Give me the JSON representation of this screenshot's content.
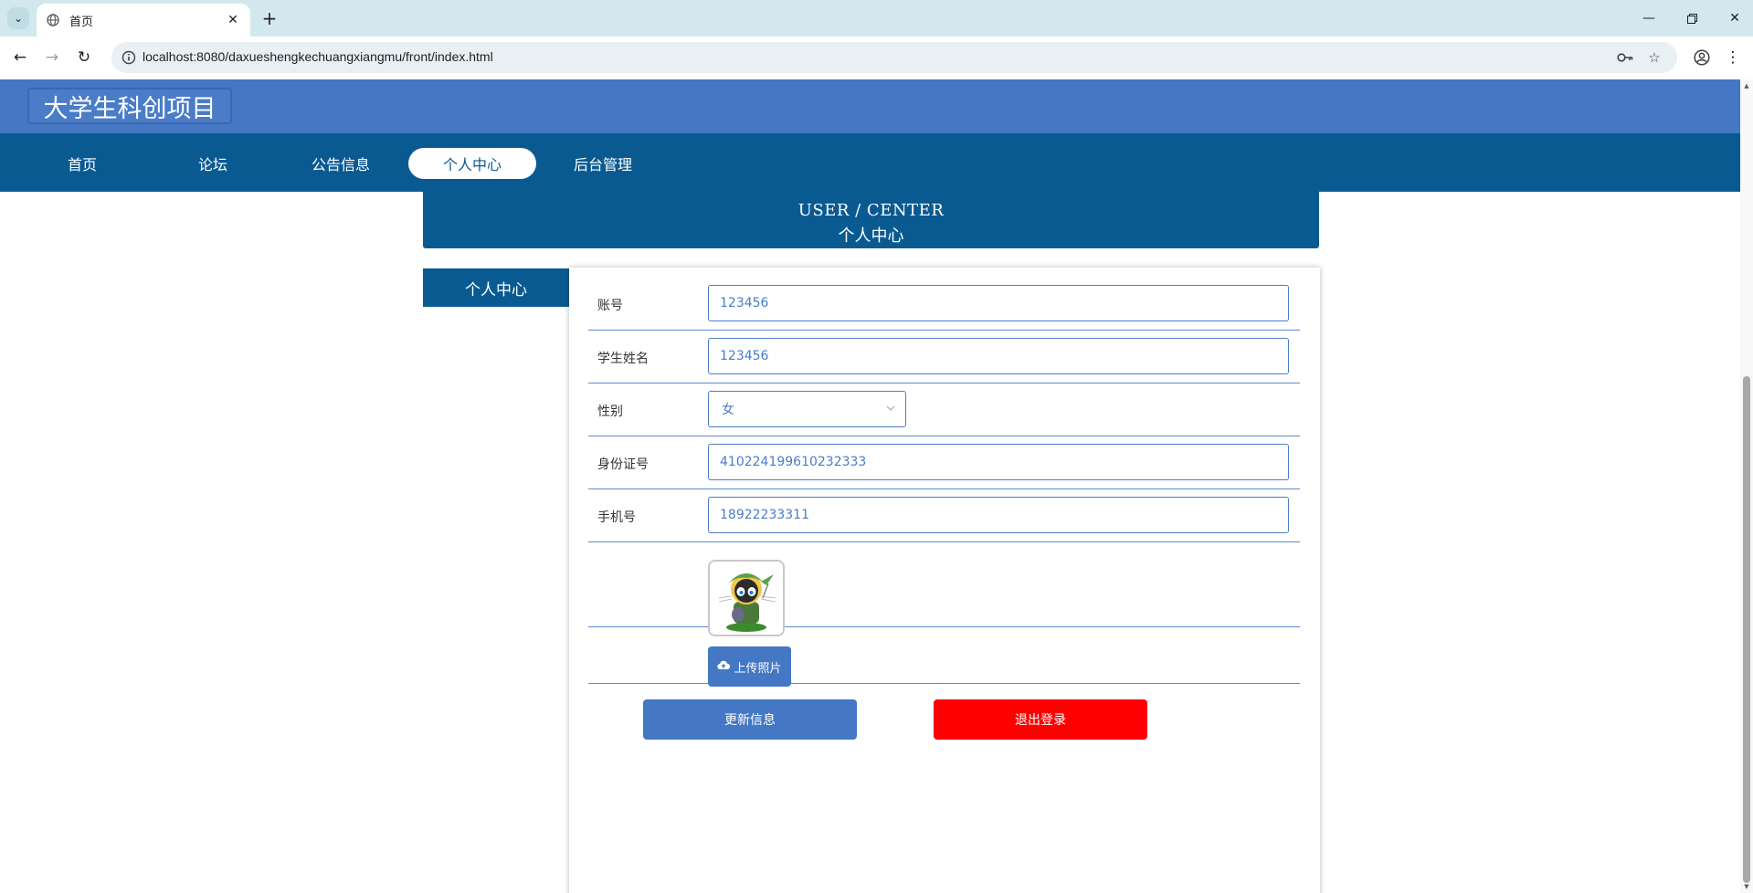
{
  "browser": {
    "tab_title": "首页",
    "url": "localhost:8080/daxueshengkechuangxiangmu/front/index.html",
    "new_tab_label": "+"
  },
  "site": {
    "title": "大学生科创项目"
  },
  "nav": {
    "items": [
      {
        "label": "首页"
      },
      {
        "label": "论坛"
      },
      {
        "label": "公告信息"
      },
      {
        "label": "个人中心",
        "active": true
      },
      {
        "label": "后台管理"
      }
    ]
  },
  "banner": {
    "en": "USER / CENTER",
    "cn": "个人中心"
  },
  "side_menu": {
    "items": [
      {
        "label": "个人中心"
      }
    ]
  },
  "form": {
    "account_label": "账号",
    "account_value": "123456",
    "name_label": "学生姓名",
    "name_value": "123456",
    "gender_label": "性别",
    "gender_value": "女",
    "id_label": "身份证号",
    "id_value": "410224199610232333",
    "phone_label": "手机号",
    "phone_value": "18922233311",
    "upload_label": "上传照片",
    "update_label": "更新信息",
    "logout_label": "退出登录"
  },
  "colors": {
    "header": "#4477c4",
    "nav": "#0a5a92",
    "primary_button": "#4477c4",
    "danger_button": "#ff0000"
  }
}
